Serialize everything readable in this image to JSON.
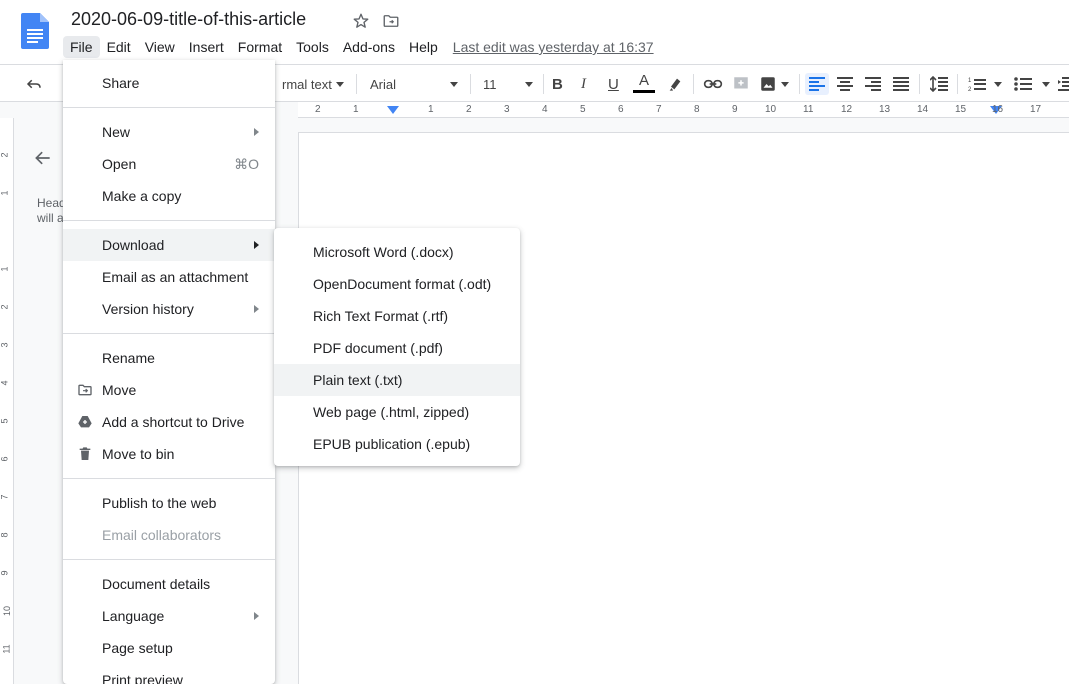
{
  "document": {
    "title": "2020-06-09-title-of-this-article",
    "last_edit": "Last edit was yesterday at 16:37"
  },
  "menubar": {
    "items": [
      {
        "label": "File",
        "active": true
      },
      {
        "label": "Edit"
      },
      {
        "label": "View"
      },
      {
        "label": "Insert"
      },
      {
        "label": "Format"
      },
      {
        "label": "Tools"
      },
      {
        "label": "Add-ons"
      },
      {
        "label": "Help"
      }
    ]
  },
  "toolbar": {
    "style_select": "rmal text",
    "font_select": "Arial",
    "font_size": "11",
    "icons": [
      "undo-icon",
      "redo-icon",
      "bold-icon",
      "italic-icon",
      "underline-icon",
      "text-color-icon",
      "highlight-icon",
      "link-icon",
      "add-comment-icon",
      "insert-image-icon",
      "align-left-icon",
      "align-center-icon",
      "align-right-icon",
      "justify-icon",
      "line-spacing-icon",
      "numbered-list-icon",
      "bulleted-list-icon"
    ]
  },
  "ruler": {
    "numbers": [
      "2",
      "1",
      "1",
      "2",
      "3",
      "4",
      "5",
      "6",
      "7",
      "8",
      "9",
      "10",
      "11",
      "12",
      "13",
      "14",
      "15",
      "16",
      "17"
    ]
  },
  "vertical_ruler": {
    "numbers": [
      "2",
      "1",
      "1",
      "2",
      "3",
      "4",
      "5",
      "6",
      "7",
      "8",
      "9",
      "10",
      "11"
    ]
  },
  "outline": {
    "text_line1": "Head",
    "text_line2": "will a"
  },
  "file_menu": {
    "share": "Share",
    "new": "New",
    "open": "Open",
    "open_shortcut": "⌘O",
    "make_copy": "Make a copy",
    "download": "Download",
    "email_attachment": "Email as an attachment",
    "version_history": "Version history",
    "rename": "Rename",
    "move": "Move",
    "add_shortcut": "Add a shortcut to Drive",
    "move_to_bin": "Move to bin",
    "publish": "Publish to the web",
    "email_collaborators": "Email collaborators",
    "document_details": "Document details",
    "language": "Language",
    "page_setup": "Page setup",
    "print_preview": "Print preview"
  },
  "download_menu": {
    "items": [
      "Microsoft Word (.docx)",
      "OpenDocument format (.odt)",
      "Rich Text Format (.rtf)",
      "PDF document (.pdf)",
      "Plain text (.txt)",
      "Web page (.html, zipped)",
      "EPUB publication (.epub)"
    ],
    "highlighted": "Plain text (.txt)"
  },
  "colors": {
    "doc_blue": "#4285f4",
    "accent": "#1a73e8",
    "menu_highlight": "#f1f3f4"
  }
}
